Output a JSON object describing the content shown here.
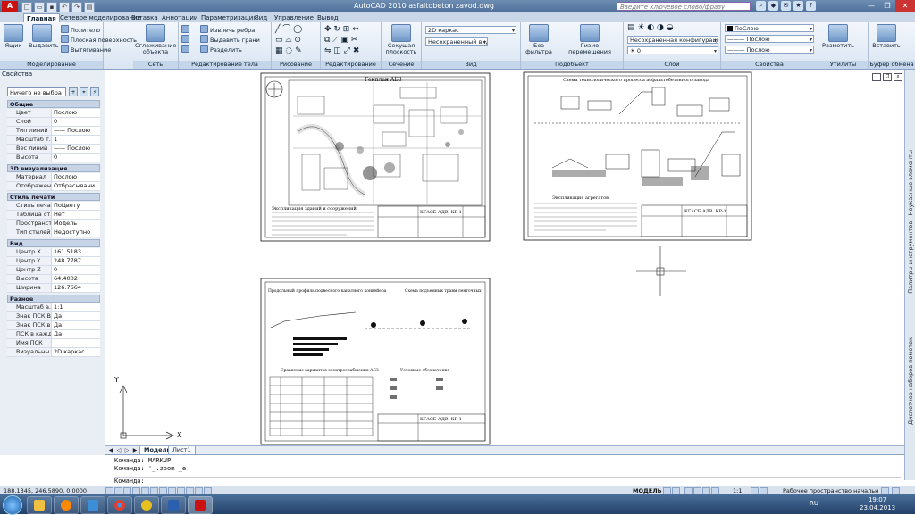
{
  "window": {
    "title": "AutoCAD 2010   asfaltobeton zavod.dwg",
    "help_placeholder": "Введите ключевое слово/фразу",
    "controls": [
      "—",
      "❐",
      "✕"
    ]
  },
  "ribbon_tabs": [
    "Главная",
    "Сетевое моделирование",
    "Вставка",
    "Аннотации",
    "Параметризация",
    "Вид",
    "Управление",
    "Вывод"
  ],
  "ribbon": {
    "modeling": {
      "title": "Моделирование",
      "box": "Ящик",
      "extract": "Выдавить",
      "polybody": "Политело",
      "planesurf": "Плоская поверхность",
      "extrude": "Вытягивание"
    },
    "mesh": {
      "title": "Сеть",
      "smooth": "Сглаживание объекта"
    },
    "solid_edit": {
      "title": "Редактирование тела",
      "extract_edges": "Извлечь ребра",
      "extrude_faces": "Выдавить грани",
      "separate": "Разделить"
    },
    "draw": {
      "title": "Рисование"
    },
    "modify": {
      "title": "Редактирование"
    },
    "section": {
      "title": "Сечение",
      "plane": "Секущая плоскость"
    },
    "view": {
      "title": "Вид",
      "style": "2D каркас",
      "saved_view": "Несохраненный вид"
    },
    "subobject": {
      "title": "Подобъект",
      "no_filter": "Без фильтра",
      "gizmo": "Гизмо перемещения"
    },
    "layers": {
      "title": "Слои",
      "layer_state": "Несохраненная конфигурация сл",
      "layer": "0"
    },
    "properties": {
      "title": "Свойства",
      "color": "ПоСлою",
      "linetype": "Послою",
      "lineweight": "Послою"
    },
    "utilities": {
      "title": "Утилиты",
      "measure": "Разметить"
    },
    "clipboard": {
      "title": "Буфер обмена",
      "paste": "Вставить"
    }
  },
  "properties_palette": {
    "title": "Свойства",
    "selection": "Ничего не выбра",
    "sections": [
      {
        "name": "Общие",
        "rows": [
          [
            "Цвет",
            "Послою"
          ],
          [
            "Слой",
            "0"
          ],
          [
            "Тип линий",
            "—— Послою"
          ],
          [
            "Масштаб т...",
            "1"
          ],
          [
            "Вес линий",
            "—— Послою"
          ],
          [
            "Высота",
            "0"
          ]
        ]
      },
      {
        "name": "3D визуализация",
        "rows": [
          [
            "Материал",
            "Послою"
          ],
          [
            "Отображен...",
            "Отбрасывани..."
          ]
        ]
      },
      {
        "name": "Стиль печати",
        "rows": [
          [
            "Стиль печати",
            "ПоЦвету"
          ],
          [
            "Таблица ст...",
            "Нет"
          ],
          [
            "Пространст...",
            "Модель"
          ],
          [
            "Тип стилей ...",
            "Недоступно"
          ]
        ]
      },
      {
        "name": "Вид",
        "rows": [
          [
            "Центр X",
            "161.5183"
          ],
          [
            "Центр Y",
            "248.7787"
          ],
          [
            "Центр Z",
            "0"
          ],
          [
            "Высота",
            "64.4002"
          ],
          [
            "Ширина",
            "126.7664"
          ]
        ]
      },
      {
        "name": "Разное",
        "rows": [
          [
            "Масштаб а...",
            "1:1"
          ],
          [
            "Знак ПСК В...",
            "Да"
          ],
          [
            "Знак ПСК в ...",
            "Да"
          ],
          [
            "ПСК в кажд...",
            "Да"
          ],
          [
            "Имя ПСК",
            ""
          ],
          [
            "Визуальны...",
            "2D каркас"
          ]
        ]
      }
    ]
  },
  "right_strip_labels": [
    "Палитры инструментов - Неуказные элементы",
    "Диспетчер наборов пометок"
  ],
  "drawing": {
    "sheet1_title": "Генплан АБЗ",
    "sheet1_legend": "Экспликация зданий и сооружений.",
    "sheet1_stamp": "КГАСБ АДВ. КР-1",
    "sheet2_title": "Схема технологического процесса асфальтобетонного завода",
    "sheet2_legend": "Экспликация агрегатов.",
    "sheet2_stamp": "КГАСБ АДВ. КР-1",
    "sheet3_title1": "Продольный профиль подвесного канатного конвейера",
    "sheet3_title2": "Схема подъемных травм ленточных",
    "sheet3_table_title": "Сравнение вариантов электроснабжения АБЗ",
    "sheet3_legend": "Условные обозначения",
    "sheet3_stamp": "КГАСБ АДВ. КР-1",
    "ucs_x": "X",
    "ucs_y": "Y"
  },
  "layout_tabs": [
    "Модель",
    "Лист1"
  ],
  "command_line": {
    "lines": [
      "Команда: MARKUP",
      "Команда: '_.zoom _e",
      "Команда:"
    ]
  },
  "status_bar": {
    "coords": "188.1345, 246.5890, 0.0000",
    "mode": "МОДЕЛЬ",
    "scale": "1:1",
    "workspace": "Рабочее пространство начальн"
  },
  "taskbar": {
    "lang": "RU",
    "time": "19:07",
    "date": "23.04.2013"
  }
}
